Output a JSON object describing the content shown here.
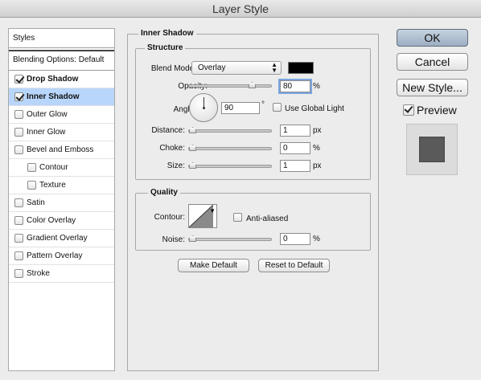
{
  "window": {
    "title": "Layer Style"
  },
  "sidebar": {
    "header": "Styles",
    "blending": "Blending Options: Default",
    "items": [
      {
        "label": "Drop Shadow",
        "checked": true,
        "selected": false,
        "bold": true,
        "indent": false
      },
      {
        "label": "Inner Shadow",
        "checked": true,
        "selected": true,
        "bold": true,
        "indent": false
      },
      {
        "label": "Outer Glow",
        "checked": false,
        "selected": false,
        "bold": false,
        "indent": false
      },
      {
        "label": "Inner Glow",
        "checked": false,
        "selected": false,
        "bold": false,
        "indent": false
      },
      {
        "label": "Bevel and Emboss",
        "checked": false,
        "selected": false,
        "bold": false,
        "indent": false
      },
      {
        "label": "Contour",
        "checked": false,
        "selected": false,
        "bold": false,
        "indent": true
      },
      {
        "label": "Texture",
        "checked": false,
        "selected": false,
        "bold": false,
        "indent": true
      },
      {
        "label": "Satin",
        "checked": false,
        "selected": false,
        "bold": false,
        "indent": false
      },
      {
        "label": "Color Overlay",
        "checked": false,
        "selected": false,
        "bold": false,
        "indent": false
      },
      {
        "label": "Gradient Overlay",
        "checked": false,
        "selected": false,
        "bold": false,
        "indent": false
      },
      {
        "label": "Pattern Overlay",
        "checked": false,
        "selected": false,
        "bold": false,
        "indent": false
      },
      {
        "label": "Stroke",
        "checked": false,
        "selected": false,
        "bold": false,
        "indent": false
      }
    ]
  },
  "panel": {
    "title": "Inner Shadow",
    "structure": {
      "title": "Structure",
      "blend_mode_label": "Blend Mode:",
      "blend_mode_value": "Overlay",
      "blend_color": "#000000",
      "opacity_label": "Opacity:",
      "opacity_value": "80",
      "opacity_unit": "%",
      "opacity_level": 0.8,
      "angle_label": "Angle:",
      "angle_value": "90",
      "angle_unit": "°",
      "use_global_light_label": "Use Global Light",
      "use_global_light_checked": false,
      "distance_label": "Distance:",
      "distance_value": "1",
      "distance_unit": "px",
      "distance_level": 0.0,
      "choke_label": "Choke:",
      "choke_value": "0",
      "choke_unit": "%",
      "choke_level": 0.0,
      "size_label": "Size:",
      "size_value": "1",
      "size_unit": "px",
      "size_level": 0.0
    },
    "quality": {
      "title": "Quality",
      "contour_label": "Contour:",
      "anti_aliased_label": "Anti-aliased",
      "anti_aliased_checked": false,
      "noise_label": "Noise:",
      "noise_value": "0",
      "noise_unit": "%",
      "noise_level": 0.0
    },
    "make_default_label": "Make Default",
    "reset_default_label": "Reset to Default"
  },
  "actions": {
    "ok_label": "OK",
    "cancel_label": "Cancel",
    "new_style_label": "New Style...",
    "preview_label": "Preview",
    "preview_checked": true
  }
}
